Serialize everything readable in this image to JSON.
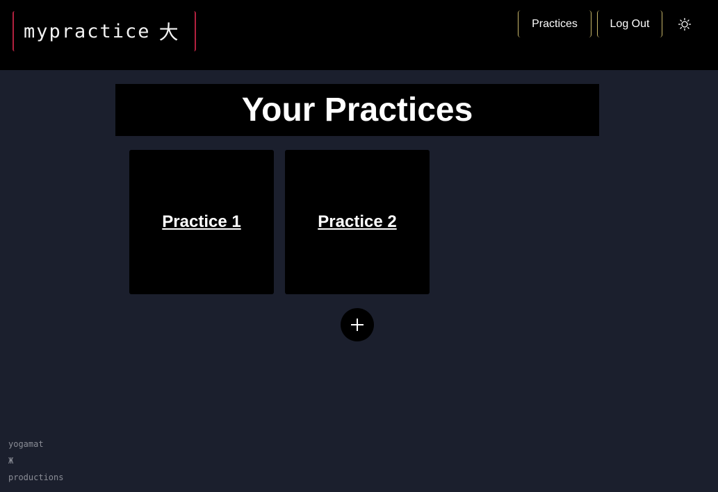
{
  "header": {
    "logo_text": "mypractice",
    "logo_glyph": "大",
    "nav": {
      "practices_label": "Practices",
      "logout_label": "Log Out"
    },
    "theme_icon": "sun-icon"
  },
  "main": {
    "title": "Your Practices",
    "practices": [
      {
        "label": "Practice 1"
      },
      {
        "label": "Practice 2"
      }
    ],
    "add_icon": "plus-icon"
  },
  "footer": {
    "line1": "yogamat",
    "line2": "Ж",
    "line3": "productions"
  },
  "colors": {
    "page_bg": "#1b1f2d",
    "header_bg": "#000000",
    "logo_accent": "#b3213f",
    "nav_accent": "#c9b86a",
    "footer_text": "#8a8d96"
  }
}
